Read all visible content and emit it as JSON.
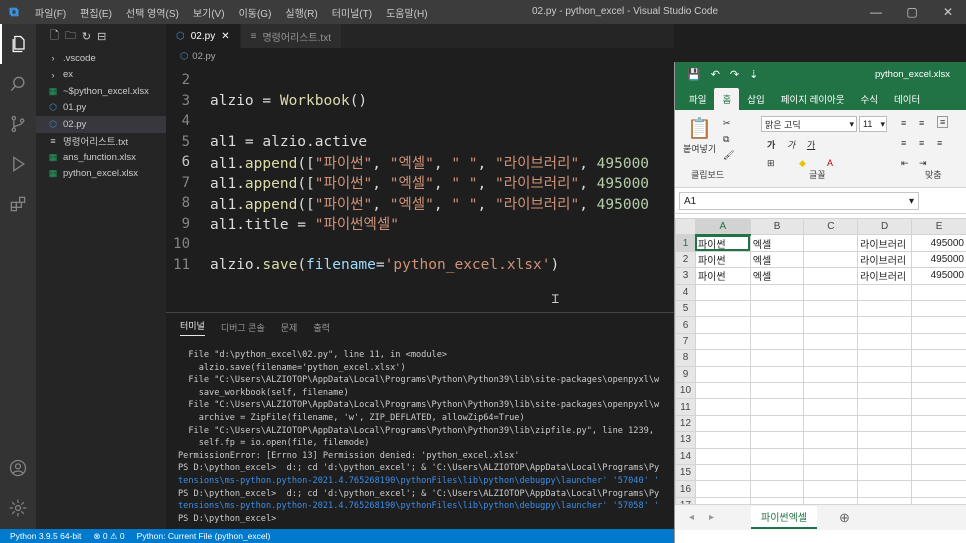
{
  "vscode": {
    "menu": [
      "파일(F)",
      "편집(E)",
      "선택 영역(S)",
      "보기(V)",
      "이동(G)",
      "실행(R)",
      "터미널(T)",
      "도움말(H)"
    ],
    "window_title": "02.py - python_excel - Visual Studio Code",
    "window_controls": [
      "—",
      "▢",
      "✕"
    ],
    "explorer": {
      "items": [
        {
          "label": ".vscode",
          "icon": "chevron-right-icon",
          "type": "folder"
        },
        {
          "label": "ex",
          "icon": "chevron-right-icon",
          "type": "folder"
        },
        {
          "label": "~$python_excel.xlsx",
          "icon": "excel-file-icon",
          "type": "file"
        },
        {
          "label": "01.py",
          "icon": "python-file-icon",
          "type": "file"
        },
        {
          "label": "02.py",
          "icon": "python-file-icon",
          "type": "file",
          "selected": true
        },
        {
          "label": "명령어리스트.txt",
          "icon": "text-file-icon",
          "type": "file"
        },
        {
          "label": "ans_function.xlsx",
          "icon": "excel-file-icon",
          "type": "file"
        },
        {
          "label": "python_excel.xlsx",
          "icon": "excel-file-icon",
          "type": "file"
        }
      ]
    },
    "tabs": [
      {
        "label": "02.py",
        "active": true,
        "close": "✕"
      },
      {
        "label": "명령어리스트.txt",
        "active": false
      }
    ],
    "breadcrumb": "02.py",
    "code_lines": [
      {
        "num": "2",
        "text": ""
      },
      {
        "num": "3",
        "text": "alzio = Workbook()"
      },
      {
        "num": "4",
        "text": ""
      },
      {
        "num": "5",
        "text": "al1 = alzio.active"
      },
      {
        "num": "6",
        "text": "al1.append([\"파이썬\", \"엑셀\", \" \", \"라이브러리\", 495000"
      },
      {
        "num": "7",
        "text": "al1.append([\"파이썬\", \"엑셀\", \" \", \"라이브러리\", 495000"
      },
      {
        "num": "8",
        "text": "al1.append([\"파이썬\", \"엑셀\", \" \", \"라이브러리\", 495000"
      },
      {
        "num": "9",
        "text": "al1.title = \"파이썬엑셀\""
      },
      {
        "num": "10",
        "text": ""
      },
      {
        "num": "11",
        "text": "alzio.save(filename='python_excel.xlsx')"
      }
    ],
    "terminal_tabs": [
      "터미널",
      "디버그 콘솔",
      "문제",
      "출력"
    ],
    "terminal_lines": [
      "  File \"d:\\python_excel\\02.py\", line 11, in <module>",
      "    alzio.save(filename='python_excel.xlsx')",
      "  File \"C:\\Users\\ALZIOTOP\\AppData\\Local\\Programs\\Python\\Python39\\lib\\site-packages\\openpyxl\\w",
      "    save_workbook(self, filename)",
      "  File \"C:\\Users\\ALZIOTOP\\AppData\\Local\\Programs\\Python\\Python39\\lib\\site-packages\\openpyxl\\w",
      "    archive = ZipFile(filename, 'w', ZIP_DEFLATED, allowZip64=True)",
      "  File \"C:\\Users\\ALZIOTOP\\AppData\\Local\\Programs\\Python\\Python39\\lib\\zipfile.py\", line 1239,",
      "    self.fp = io.open(file, filemode)",
      "PermissionError: [Errno 13] Permission denied: 'python_excel.xlsx'",
      "PS D:\\python_excel>  d:; cd 'd:\\python_excel'; & 'C:\\Users\\ALZIOTOP\\AppData\\Local\\Programs\\Py",
      "tensions\\ms-python.python-2021.4.765268190\\pythonFiles\\lib\\python\\debugpy\\launcher' '57040' '",
      "PS D:\\python_excel>  d:; cd 'd:\\python_excel'; & 'C:\\Users\\ALZIOTOP\\AppData\\Local\\Programs\\Py",
      "tensions\\ms-python.python-2021.4.765268190\\pythonFiles\\lib\\python\\debugpy\\launcher' '57058' '",
      "PS D:\\python_excel> "
    ],
    "status": {
      "python": "Python 3.9.5 64-bit",
      "problems": "⊗ 0 ⚠ 0",
      "run": "Python: Current File (python_excel)"
    }
  },
  "excel": {
    "filename": "python_excel.xlsx",
    "ribbon_tabs": [
      "파일",
      "홈",
      "삽입",
      "페이지 레이아웃",
      "수식",
      "데이터"
    ],
    "active_tab": "홈",
    "font_name": "맑은 고딕",
    "font_size": "11",
    "paste_label": "붙여넣기",
    "groups": [
      "클립보드",
      "글꼴",
      "맞춤"
    ],
    "bold": "가",
    "italic": "가",
    "underline": "가",
    "name_box": "A1",
    "columns": [
      "A",
      "B",
      "C",
      "D",
      "E"
    ],
    "rows": [
      [
        "파이썬",
        "엑셀",
        "",
        "라이브러리",
        "495000"
      ],
      [
        "파이썬",
        "엑셀",
        "",
        "라이브러리",
        "495000"
      ],
      [
        "파이썬",
        "엑셀",
        "",
        "라이브러리",
        "495000"
      ],
      [
        "",
        "",
        "",
        "",
        ""
      ],
      [
        "",
        "",
        "",
        "",
        ""
      ],
      [
        "",
        "",
        "",
        "",
        ""
      ],
      [
        "",
        "",
        "",
        "",
        ""
      ],
      [
        "",
        "",
        "",
        "",
        ""
      ],
      [
        "",
        "",
        "",
        "",
        ""
      ],
      [
        "",
        "",
        "",
        "",
        ""
      ],
      [
        "",
        "",
        "",
        "",
        ""
      ],
      [
        "",
        "",
        "",
        "",
        ""
      ],
      [
        "",
        "",
        "",
        "",
        ""
      ],
      [
        "",
        "",
        "",
        "",
        ""
      ],
      [
        "",
        "",
        "",
        "",
        ""
      ],
      [
        "",
        "",
        "",
        "",
        ""
      ],
      [
        "",
        "",
        "",
        "",
        ""
      ]
    ],
    "sheet_name": "파이썬엑셀",
    "add_sheet": "⊕"
  }
}
